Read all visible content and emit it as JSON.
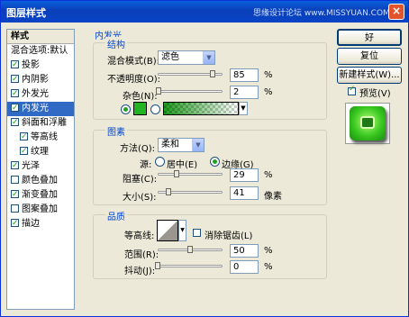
{
  "window": {
    "title": "图层样式",
    "watermark": "思缘设计论坛 www.MISSYUAN.COM",
    "close": "×"
  },
  "sidebar": {
    "header": "样式",
    "items": [
      {
        "label": "混合选项:默认",
        "check": false,
        "hascb": false,
        "indent": false,
        "selected": false
      },
      {
        "label": "投影",
        "check": true,
        "hascb": true,
        "indent": false,
        "selected": false
      },
      {
        "label": "内阴影",
        "check": true,
        "hascb": true,
        "indent": false,
        "selected": false
      },
      {
        "label": "外发光",
        "check": true,
        "hascb": true,
        "indent": false,
        "selected": false
      },
      {
        "label": "内发光",
        "check": true,
        "hascb": true,
        "indent": false,
        "selected": true
      },
      {
        "label": "斜面和浮雕",
        "check": true,
        "hascb": true,
        "indent": false,
        "selected": false
      },
      {
        "label": "等高线",
        "check": true,
        "hascb": true,
        "indent": true,
        "selected": false
      },
      {
        "label": "纹理",
        "check": true,
        "hascb": true,
        "indent": true,
        "selected": false
      },
      {
        "label": "光泽",
        "check": true,
        "hascb": true,
        "indent": false,
        "selected": false
      },
      {
        "label": "颜色叠加",
        "check": false,
        "hascb": true,
        "indent": false,
        "selected": false
      },
      {
        "label": "渐变叠加",
        "check": true,
        "hascb": true,
        "indent": false,
        "selected": false
      },
      {
        "label": "图案叠加",
        "check": false,
        "hascb": true,
        "indent": false,
        "selected": false
      },
      {
        "label": "描边",
        "check": true,
        "hascb": true,
        "indent": false,
        "selected": false
      }
    ]
  },
  "inner_glow": {
    "title": "内发光",
    "structure": {
      "title": "结构",
      "blend_mode_label": "混合模式(B):",
      "blend_mode": "滤色",
      "opacity_label": "不透明度(O):",
      "opacity": "85",
      "opacity_pct": 85,
      "noise_label": "杂色(N):",
      "noise": "2",
      "noise_pct": 2,
      "unit": "%"
    },
    "elements": {
      "title": "图素",
      "method_label": "方法(Q):",
      "method": "柔和",
      "source_label": "源:",
      "center_label": "居中(E)",
      "edge_label": "边缘(G)",
      "source_selected": "edge",
      "choke_label": "阻塞(C):",
      "choke": "29",
      "choke_pct": 29,
      "size_label": "大小(S):",
      "size": "41",
      "size_pct": 16.4,
      "unit_pct": "%",
      "unit_px": "像素"
    },
    "quality": {
      "title": "品质",
      "contour_label": "等高线:",
      "antialias_label": "消除锯齿(L)",
      "antialias": false,
      "range_label": "范围(R):",
      "range": "50",
      "range_pct": 50,
      "jitter_label": "抖动(J):",
      "jitter": "0",
      "jitter_pct": 0,
      "unit": "%"
    }
  },
  "buttons": {
    "ok": "好",
    "reset": "复位",
    "new_style": "新建样式(W)...",
    "preview": "预览(V)",
    "preview_checked": true
  },
  "colors": {
    "glow_color": "#22b422",
    "gradient_start": "#1e9e1e",
    "accent": "#316ac5"
  }
}
